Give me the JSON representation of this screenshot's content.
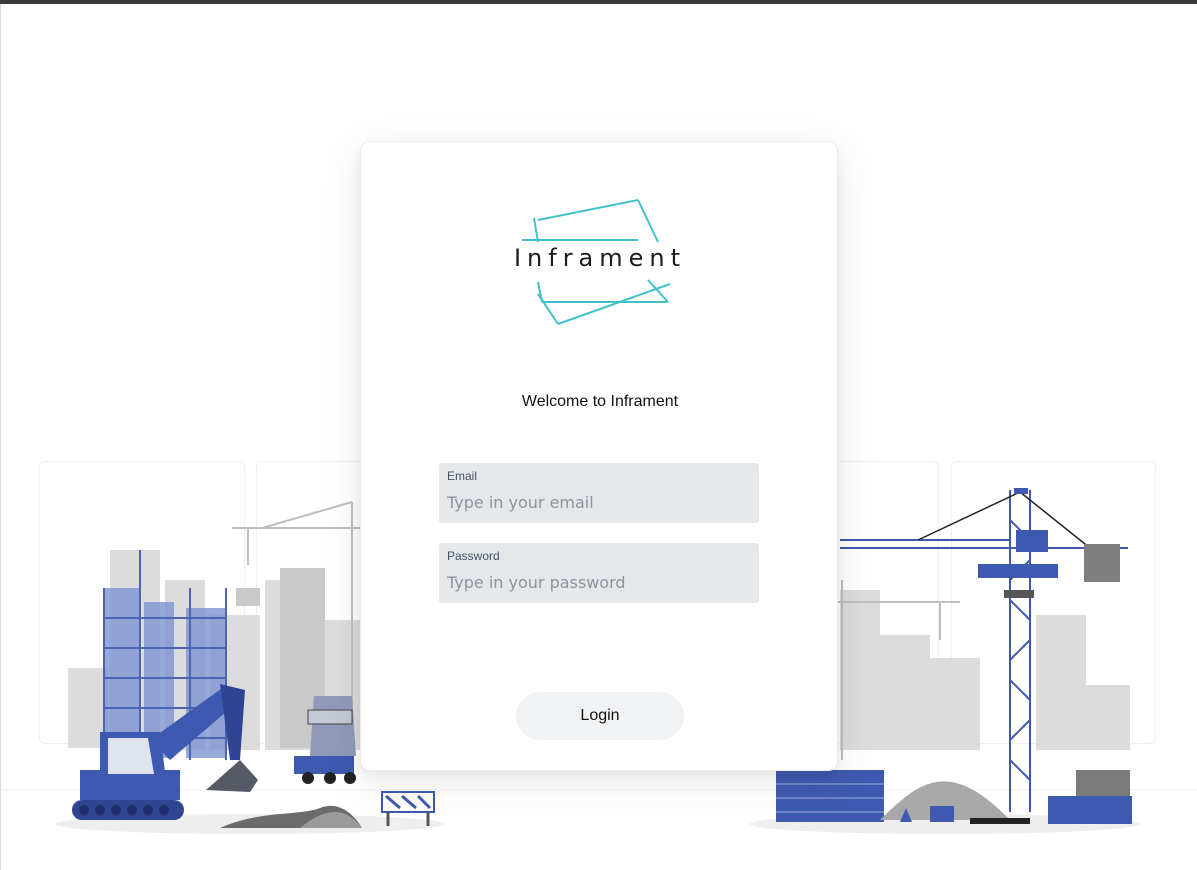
{
  "brand": {
    "name": "Inframent",
    "accent_color": "#3fc1c9"
  },
  "card": {
    "welcome_text": "Welcome to Inframent"
  },
  "form": {
    "email": {
      "label": "Email",
      "placeholder": "Type in your email",
      "value": ""
    },
    "password": {
      "label": "Password",
      "placeholder": "Type in your password",
      "value": ""
    },
    "login_label": "Login"
  },
  "icons": [
    "inframent-logo",
    "construction-illustration"
  ],
  "colors": {
    "illustration_blue": "#3e5ab0",
    "illustration_grey": "#d8d8d8",
    "input_bg": "#e6e7ea"
  }
}
